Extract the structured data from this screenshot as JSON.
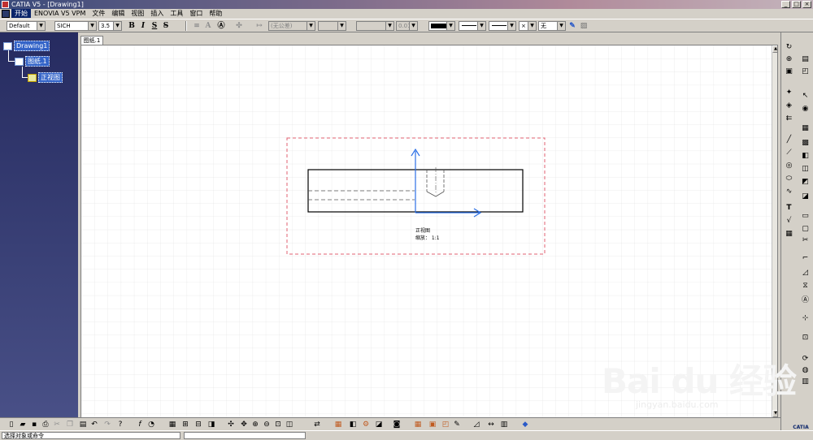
{
  "window": {
    "title": "CATIA V5 - [Drawing1]",
    "controls": [
      "_",
      "□",
      "×"
    ]
  },
  "menubar": {
    "items": [
      "开始",
      "ENOVIA V5 VPM",
      "文件",
      "编辑",
      "视图",
      "插入",
      "工具",
      "窗口",
      "帮助"
    ],
    "active_index": 0
  },
  "toolbar": {
    "style_value": "Default",
    "font_value": "SICH",
    "font_size_value": "3.5",
    "bold_label": "B",
    "italic_label": "I",
    "underline_label": "S",
    "strike_label": "S̶",
    "tolerance_value": "(无公差)",
    "precision_value": "0.010",
    "line_pattern_value": "无"
  },
  "tree": {
    "root_label": "Drawing1",
    "sheet_label": "图纸.1",
    "view_label": "正视图"
  },
  "canvas": {
    "sheet_tab_label": "图纸.1",
    "view_caption_line1": "正视图",
    "view_caption_line2": "缩放：  1:1"
  },
  "statusbar": {
    "message": "选择对象或命令",
    "command_input": ""
  },
  "watermark": {
    "text": "Bai du 经验",
    "subtext": "jingyan.baidu.com"
  },
  "brand": {
    "logo_text": "CATIA"
  },
  "colors": {
    "tree_background": "#2f3570",
    "selection": "#3464c8",
    "axis": "#2b6fe6",
    "view_frame": "#e06070",
    "grid": "#e8e8e8"
  }
}
